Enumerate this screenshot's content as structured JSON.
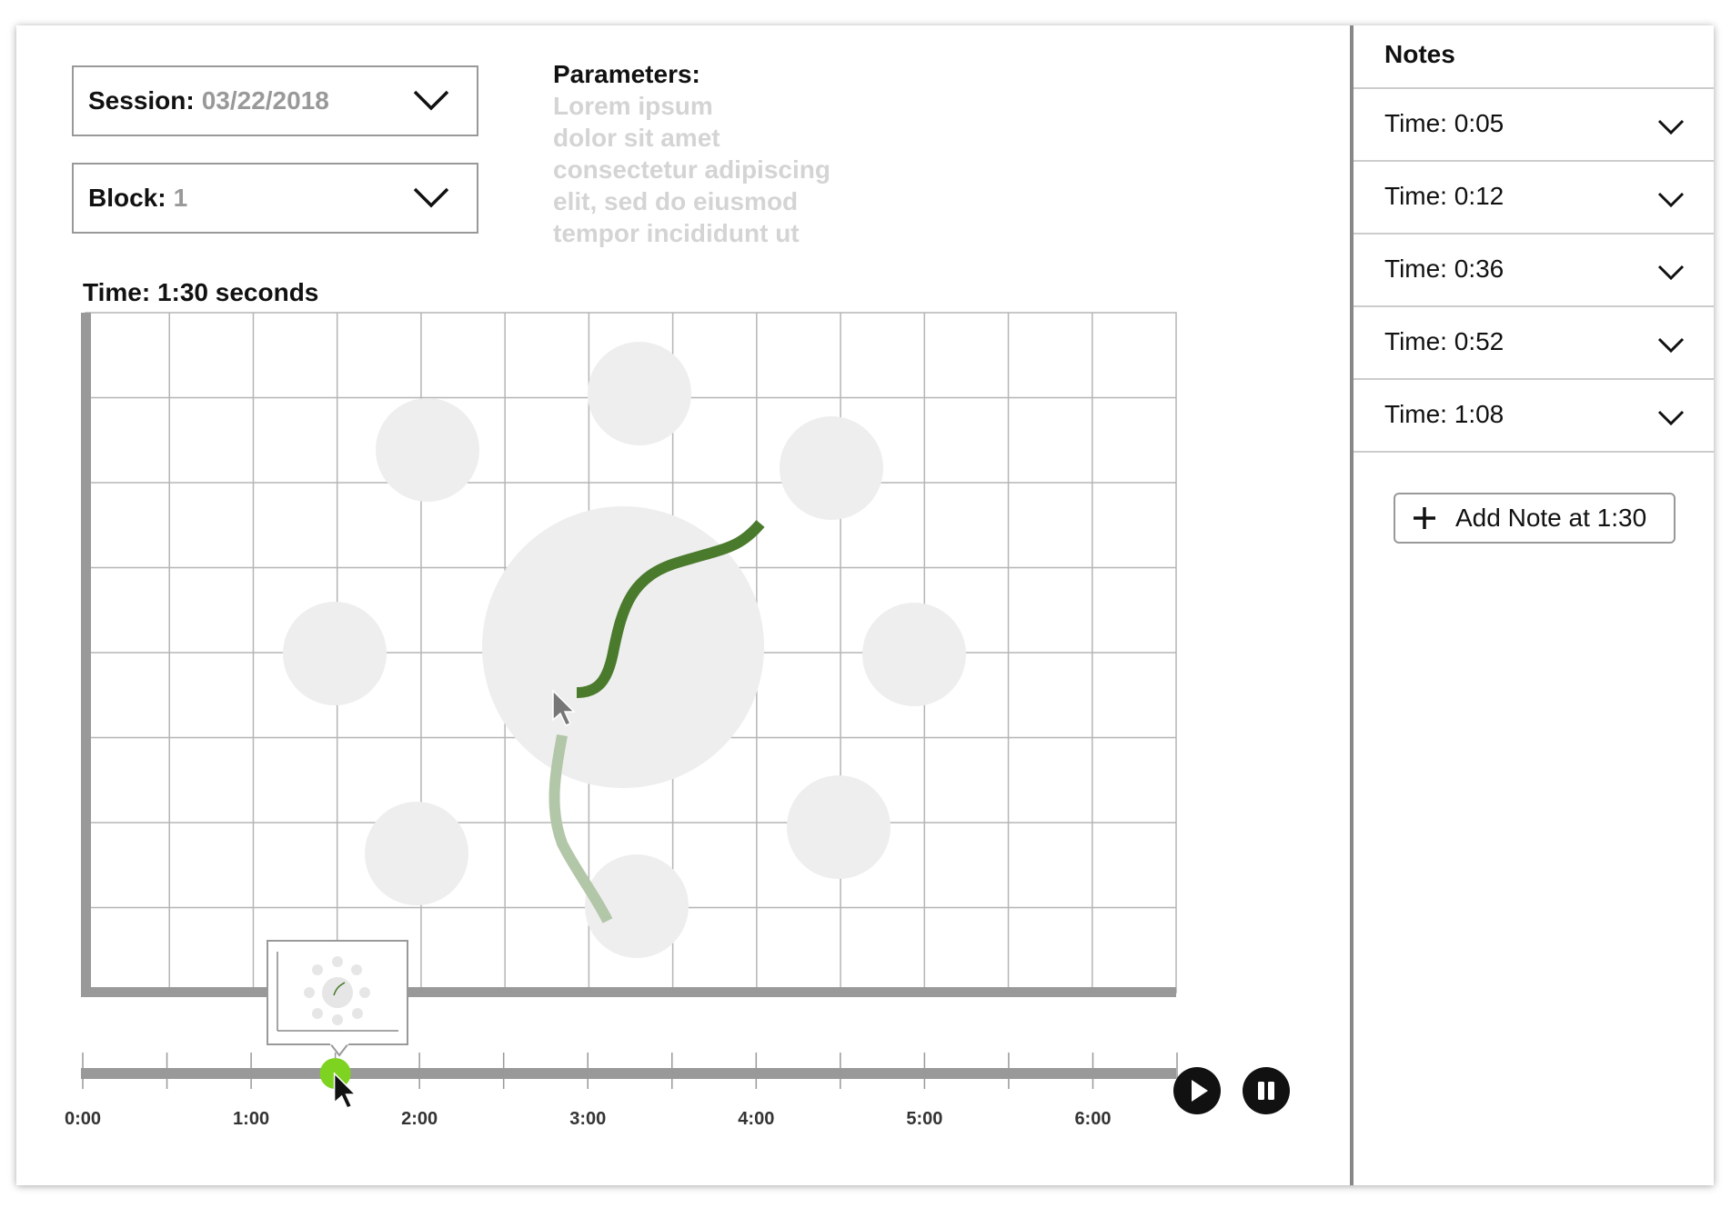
{
  "session": {
    "label": "Session:",
    "value": "03/22/2018"
  },
  "block": {
    "label": "Block:",
    "value": "1"
  },
  "parameters": {
    "title": "Parameters:",
    "lines": [
      "Lorem ipsum",
      "dolor sit amet",
      "consectetur adipiscing",
      "elit, sed do eiusmod",
      "tempor incididunt ut"
    ]
  },
  "time_label": "Time: 1:30 seconds",
  "timeline": {
    "ticks": [
      "0:00",
      "1:00",
      "2:00",
      "3:00",
      "4:00",
      "5:00",
      "6:00"
    ],
    "duration_seconds": 390,
    "current_seconds": 90
  },
  "controls": {
    "play_icon": "play-icon",
    "pause_icon": "pause-icon"
  },
  "notes": {
    "title": "Notes",
    "items": [
      {
        "label": "Time: 0:05"
      },
      {
        "label": "Time: 0:12"
      },
      {
        "label": "Time: 0:36"
      },
      {
        "label": "Time: 0:52"
      },
      {
        "label": "Time: 1:08"
      }
    ],
    "add_label": "Add Note at 1:30"
  },
  "colors": {
    "trail_dark": "#4a7a2c",
    "trail_light": "#b2c6a8",
    "scrubber_thumb": "#7ed321",
    "target": "#eeeeee",
    "grid": "#b5b5b5",
    "axis": "#999999"
  }
}
